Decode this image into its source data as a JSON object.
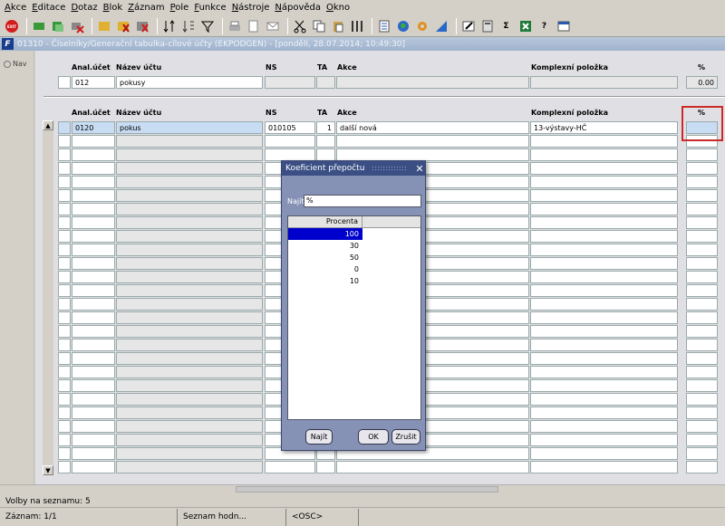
{
  "menu": [
    "Akce",
    "Editace",
    "Dotaz",
    "Blok",
    "Záznam",
    "Pole",
    "Funkce",
    "Nástroje",
    "Nápověda",
    "Okno"
  ],
  "window": {
    "title": "01310 - Číselníky/Generační tabulka-cílové účty (EKPODGEN) - [pondělí, 28.07.2014; 10:49:30]",
    "icon_label": "F"
  },
  "nav": {
    "label": "Nav"
  },
  "colors": {
    "title_bg": "#9fb2cc",
    "dialog_bg": "#8592b6",
    "dialog_title": "#3b4f85",
    "selection": "#0000cc",
    "highlight_border": "#cc2a2a"
  },
  "top_block": {
    "headers": {
      "anal": "Anal.účet",
      "nazev": "Název účtu",
      "ns": "NS",
      "ta": "TA",
      "akce": "Akce",
      "komplex": "Komplexní položka",
      "pct": "%"
    },
    "row": {
      "anal": "012",
      "nazev": "pokusy",
      "ns": "",
      "ta": "",
      "akce": "",
      "komplex": "",
      "pct": "0.00"
    }
  },
  "detail_block": {
    "headers": {
      "anal": "Anal.účet",
      "nazev": "Název účtu",
      "ns": "NS",
      "ta": "TA",
      "akce": "Akce",
      "komplex": "Komplexní položka",
      "pct": "%"
    },
    "row": {
      "anal": "0120",
      "nazev": "pokus",
      "ns": "010105",
      "ta": "1",
      "akce": "další nová",
      "komplex": "13-výstavy-HČ",
      "pct": ""
    }
  },
  "dialog": {
    "title": "Koeficient přepočtu",
    "find_label": "Najít",
    "find_value": "%",
    "column_header": "Procenta",
    "items": [
      "100",
      "30",
      "50",
      "0",
      "10"
    ],
    "selected_index": 0,
    "buttons": {
      "find": "Najít",
      "ok": "OK",
      "cancel": "Zrušit"
    }
  },
  "status": {
    "line1": "Volby na seznamu: 5",
    "record": "Záznam: 1/1",
    "list": "Seznam hodn...",
    "osc": "<OSC>"
  }
}
